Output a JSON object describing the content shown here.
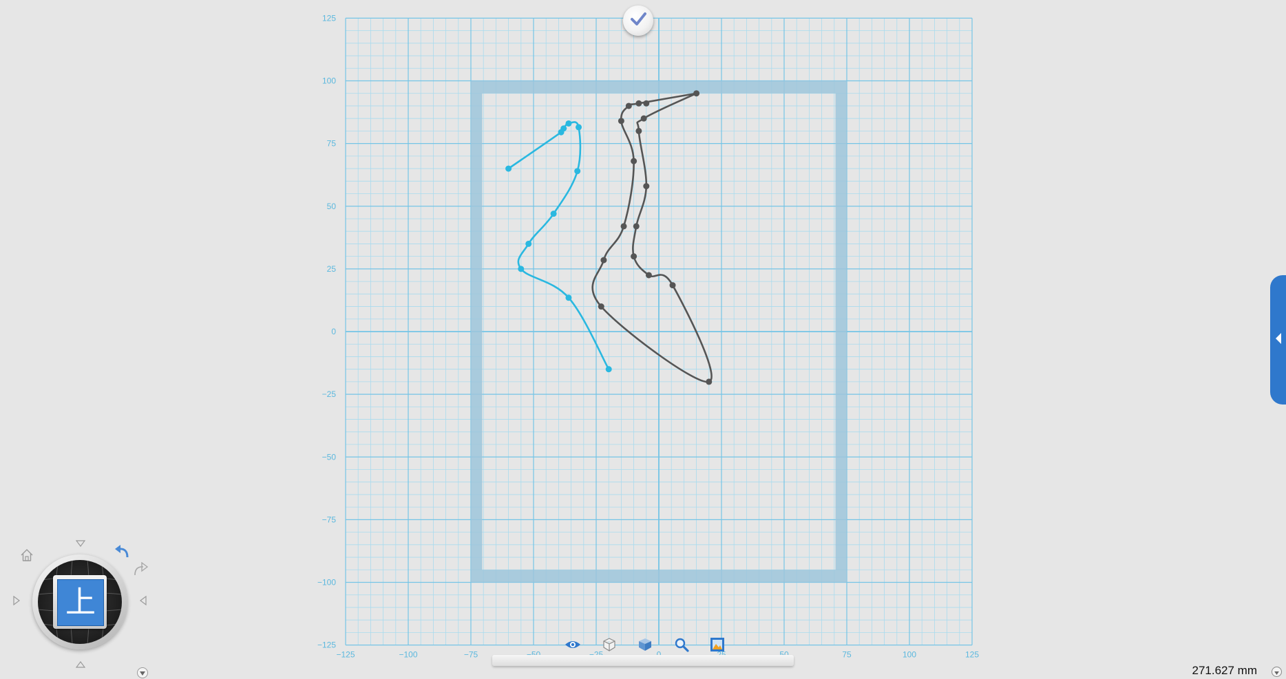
{
  "accept_button": {
    "label": ""
  },
  "status_bar": {
    "measurement": "271.627 mm"
  },
  "view_cube": {
    "face_label": "上"
  },
  "colors": {
    "background": "#e6e6e6",
    "grid_minor": "#a9dbee",
    "grid_major": "#74c4e6",
    "axis_label": "#5bb8de",
    "frame": "#9ec6da",
    "curve_active": "#2ab8e0",
    "curve_inactive": "#555555",
    "accent": "#2f78cc"
  },
  "icons": {
    "accept": "checkmark-icon",
    "side_tab": "chevron-left-icon",
    "home": "home-icon",
    "undo": "undo-arrow-icon",
    "redo": "redo-arrow-icon",
    "tools": [
      "eye-icon",
      "wireframe-cube-icon",
      "solid-cube-icon",
      "zoom-icon",
      "image-frame-icon"
    ]
  },
  "sketch": {
    "x_ticks": [
      -125,
      -100,
      -75,
      -50,
      -25,
      0,
      25,
      50,
      75,
      100,
      125
    ],
    "y_ticks": [
      125,
      100,
      75,
      50,
      25,
      0,
      -25,
      -50,
      -75,
      -100,
      -125
    ],
    "x_tick_labels": [
      "−125",
      "−100",
      "−75",
      "−50",
      "−25",
      "0",
      "25",
      "50",
      "75",
      "100",
      "125"
    ],
    "y_tick_labels": [
      "125",
      "100",
      "75",
      "50",
      "25",
      "0",
      "−25",
      "−50",
      "−75",
      "−100",
      "−125"
    ],
    "frame_outer": {
      "x": [
        -75,
        75
      ],
      "y": [
        -100,
        100
      ]
    },
    "frame_inner": {
      "x": [
        -70.5,
        70.5
      ],
      "y": [
        -95,
        95
      ]
    },
    "curves": [
      {
        "name": "blue-curve",
        "color": "#2ab8e0",
        "points": [
          [
            -60,
            65
          ],
          [
            -39,
            79.5
          ],
          [
            -38,
            81
          ],
          [
            -36,
            83
          ],
          [
            -32,
            81.5
          ],
          [
            -32.5,
            64
          ],
          [
            -42,
            47
          ],
          [
            -52,
            35
          ],
          [
            -55,
            25
          ],
          [
            -36,
            13.5
          ],
          [
            -20,
            -15
          ]
        ]
      },
      {
        "name": "dark-curve-outer",
        "color": "#555555",
        "points": [
          [
            15,
            95
          ],
          [
            -8,
            91
          ],
          [
            -12,
            90
          ],
          [
            -15,
            84
          ],
          [
            -10,
            68
          ],
          [
            -14,
            42
          ],
          [
            -22,
            28.5
          ],
          [
            -23,
            10
          ],
          [
            20,
            -20
          ],
          [
            5.5,
            18.5
          ],
          [
            -4,
            22.5
          ],
          [
            -10,
            30
          ],
          [
            -9,
            42
          ],
          [
            -5,
            58
          ],
          [
            -8,
            80
          ],
          [
            -6,
            85
          ],
          [
            15,
            95
          ]
        ]
      }
    ],
    "dark_curve_points": [
      [
        15,
        95
      ],
      [
        -5,
        91
      ],
      [
        -8,
        91
      ],
      [
        -12,
        90
      ],
      [
        -15,
        84
      ],
      [
        -10,
        68
      ],
      [
        -14,
        42
      ],
      [
        -22,
        28.5
      ],
      [
        -23,
        10
      ],
      [
        20,
        -20
      ],
      [
        5.5,
        18.5
      ],
      [
        -4,
        22.5
      ],
      [
        -10,
        30
      ],
      [
        -9,
        42
      ],
      [
        -5,
        58
      ],
      [
        -8,
        80
      ],
      [
        -6,
        85
      ]
    ]
  }
}
